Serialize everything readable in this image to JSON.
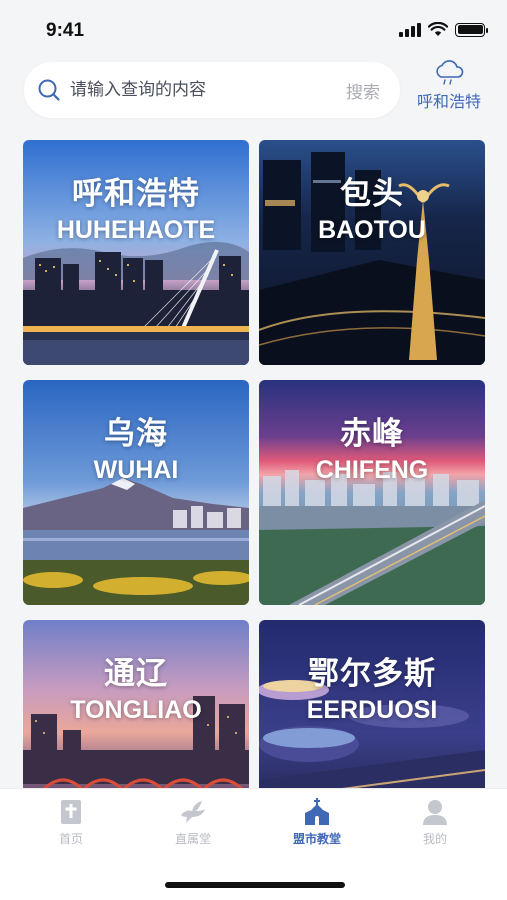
{
  "status_bar": {
    "time": "9:41"
  },
  "search": {
    "placeholder": "请输入查询的内容",
    "button_label": "搜索"
  },
  "city_picker": {
    "label": "呼和浩特",
    "icon": "cloud-icon"
  },
  "cities": [
    {
      "cn": "呼和浩特",
      "en": "HUHEHAOTE"
    },
    {
      "cn": "包头",
      "en": "BAOTOU"
    },
    {
      "cn": "乌海",
      "en": "WUHAI"
    },
    {
      "cn": "赤峰",
      "en": "CHIFENG"
    },
    {
      "cn": "通辽",
      "en": "TONGLIAO"
    },
    {
      "cn": "鄂尔多斯",
      "en": "EERDUOSI"
    }
  ],
  "tabs": [
    {
      "label": "首页",
      "icon": "bible-icon",
      "active": false
    },
    {
      "label": "直属堂",
      "icon": "dove-icon",
      "active": false
    },
    {
      "label": "盟市教堂",
      "icon": "church-icon",
      "active": true
    },
    {
      "label": "我的",
      "icon": "user-icon",
      "active": false
    }
  ],
  "colors": {
    "accent": "#3f68b5",
    "inactive": "#b8bbc2",
    "background": "#f4f5f7"
  }
}
